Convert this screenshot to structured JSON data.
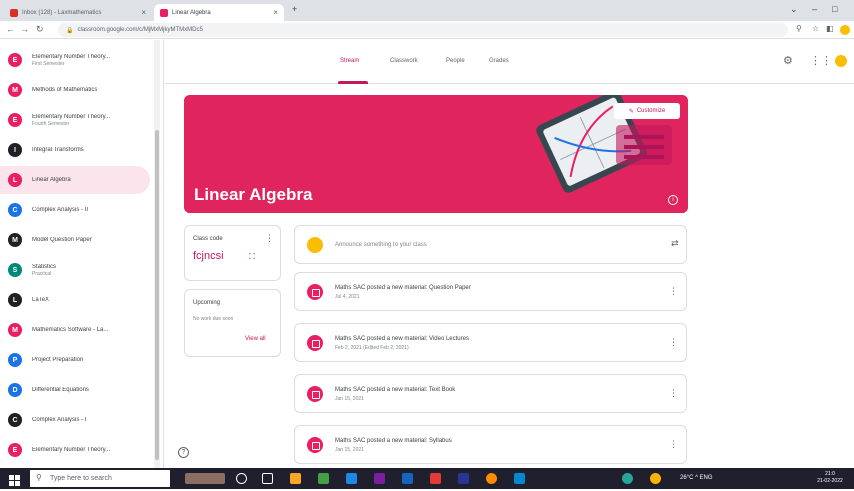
{
  "browser": {
    "tabs": [
      {
        "label": "Inbox (128) - Laxmathematics",
        "color": "#d93025"
      },
      {
        "label": "Linear Algebra",
        "color": "#e91e63"
      }
    ],
    "new_tab": "+",
    "url": "classroom.google.com/c/MjMxMjkyMTMxMDc5"
  },
  "sidebar": {
    "items": [
      {
        "initial": "E",
        "name": "Elementary Number Theory...",
        "sub": "First Semester",
        "color": "#e91e63"
      },
      {
        "initial": "M",
        "name": "Methods of Mathematics",
        "sub": "",
        "color": "#e91e63"
      },
      {
        "initial": "E",
        "name": "Elementary Number Theory...",
        "sub": "Fourth Semester",
        "color": "#e91e63"
      },
      {
        "initial": "I",
        "name": "Integral Transforms",
        "sub": "",
        "color": "#202124"
      },
      {
        "initial": "L",
        "name": "Linear Algebra",
        "sub": "",
        "color": "#e91e63"
      },
      {
        "initial": "C",
        "name": "Complex Analysis - II",
        "sub": "",
        "color": "#1a73e8"
      },
      {
        "initial": "M",
        "name": "Model Question Paper",
        "sub": "",
        "color": "#202124"
      },
      {
        "initial": "S",
        "name": "Statistics",
        "sub": "Practical",
        "color": "#00897b"
      },
      {
        "initial": "L",
        "name": "LaTeX",
        "sub": "",
        "color": "#202124"
      },
      {
        "initial": "M",
        "name": "Mathematics Software - La...",
        "sub": "",
        "color": "#e91e63"
      },
      {
        "initial": "P",
        "name": "Project Preparation",
        "sub": "",
        "color": "#1a73e8"
      },
      {
        "initial": "D",
        "name": "Differential Equations",
        "sub": "",
        "color": "#1a73e8"
      },
      {
        "initial": "C",
        "name": "Complex Analysis - I",
        "sub": "",
        "color": "#202124"
      },
      {
        "initial": "E",
        "name": "Elementary Number Theory...",
        "sub": "",
        "color": "#e91e63"
      }
    ]
  },
  "topnav": {
    "tabs": [
      "Stream",
      "Classwork",
      "People",
      "Grades"
    ]
  },
  "banner": {
    "title": "Linear Algebra",
    "customize": "Customize",
    "info": "i"
  },
  "class_code": {
    "label": "Class code",
    "value": "fcjncsi",
    "expand": "⛶"
  },
  "upcoming": {
    "label": "Upcoming",
    "empty": "No work due soon",
    "view_all": "View all"
  },
  "announce": {
    "placeholder": "Announce something to your class"
  },
  "posts": [
    {
      "title": "Maths SAC posted a new material: Question Paper",
      "date": "Jul 4, 2021"
    },
    {
      "title": "Maths SAC posted a new material: Video Lectures",
      "date": "Feb 2, 2021 (Edited Feb 2, 2021)"
    },
    {
      "title": "Maths SAC posted a new material: Text Book",
      "date": "Jan 15, 2021"
    },
    {
      "title": "Maths SAC posted a new material: Syllabus",
      "date": "Jan 15, 2021"
    }
  ],
  "taskbar": {
    "search_placeholder": "Type here to search",
    "tray": "26°C  ^  ENG",
    "time": "21:0",
    "date": "21-02-2022"
  },
  "colors": {
    "accent": "#c2185b",
    "banner": "#e0245e"
  }
}
